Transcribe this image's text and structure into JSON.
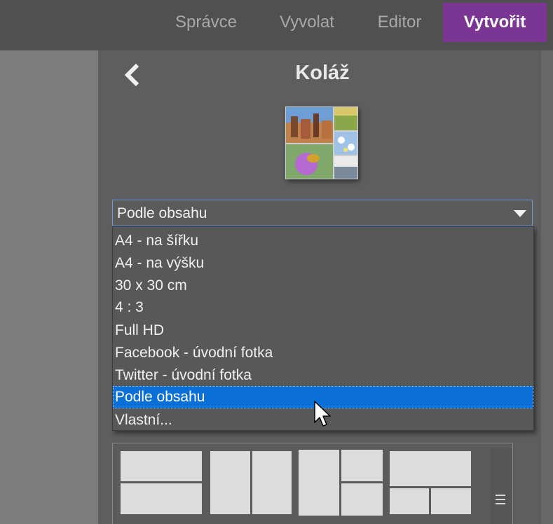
{
  "topbar": {
    "tabs": [
      {
        "label": "Správce",
        "active": false
      },
      {
        "label": "Vyvolat",
        "active": false
      },
      {
        "label": "Editor",
        "active": false
      },
      {
        "label": "Vytvořit",
        "active": true
      }
    ],
    "active_color": "#7b3592"
  },
  "panel": {
    "title": "Koláž",
    "back_icon": "chevron-left-icon"
  },
  "format_select": {
    "value": "Podle obsahu",
    "options": [
      "A4 - na šířku",
      "A4 - na výšku",
      "30 x 30 cm",
      "4 : 3",
      "Full HD",
      "Facebook - úvodní fotka",
      "Twitter - úvodní fotka",
      "Podle obsahu",
      "Vlastní..."
    ],
    "highlighted_index": 7,
    "highlight_color": "#0a6fd6"
  }
}
